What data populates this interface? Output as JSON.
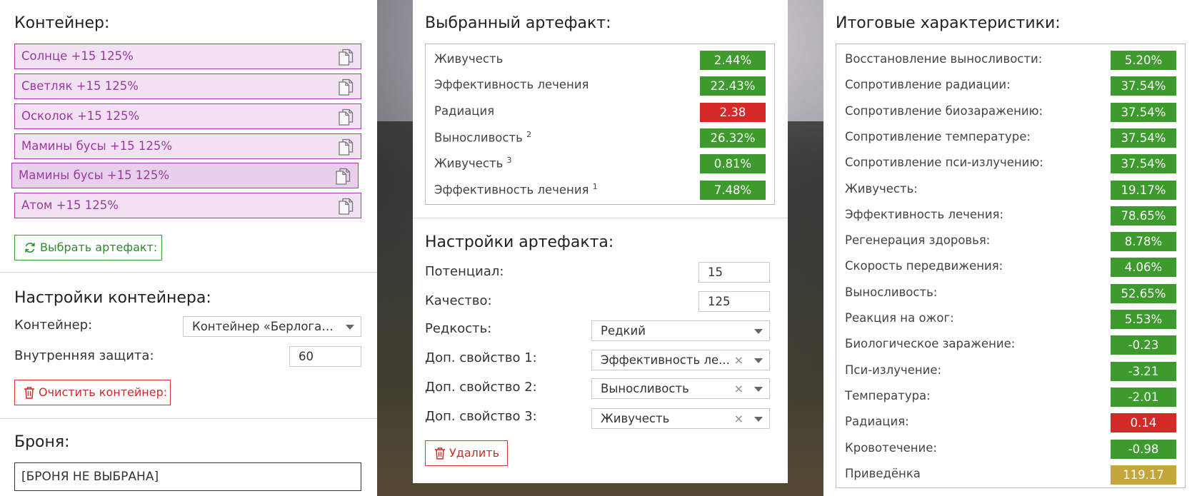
{
  "container": {
    "heading": "Контейнер:",
    "items": [
      "Солнце +15 125%",
      "Светляк +15 125%",
      "Осколок +15 125%",
      "Мамины бусы +15 125%",
      "Мамины бусы +15 125%",
      "Атом +15 125%"
    ],
    "select_button": "Выбрать артефакт:"
  },
  "container_settings": {
    "heading": "Настройки контейнера:",
    "container_label": "Контейнер:",
    "container_value": "Контейнер «Берлога…",
    "protection_label": "Внутренняя защита:",
    "protection_value": "60",
    "clear_button": "Очистить контейнер:"
  },
  "armor": {
    "heading": "Броня:",
    "value": "[БРОНЯ НЕ ВЫБРАНА]"
  },
  "selected_artifact": {
    "heading": "Выбранный артефакт:",
    "rows": [
      {
        "name": "Живучесть",
        "sup": "",
        "value": "2.44%",
        "color": "#3d9a2c"
      },
      {
        "name": "Эффективность лечения",
        "sup": "",
        "value": "22.43%",
        "color": "#3d9a2c"
      },
      {
        "name": "Радиация",
        "sup": "",
        "value": "2.38",
        "color": "#d42a27"
      },
      {
        "name": "Выносливость",
        "sup": "2",
        "value": "26.32%",
        "color": "#3d9a2c"
      },
      {
        "name": "Живучесть",
        "sup": "3",
        "value": "0.81%",
        "color": "#3d9a2c"
      },
      {
        "name": "Эффективность лечения",
        "sup": "1",
        "value": "7.48%",
        "color": "#3d9a2c"
      }
    ]
  },
  "artifact_settings": {
    "heading": "Настройки артефакта:",
    "potential_label": "Потенциал:",
    "potential_value": "15",
    "quality_label": "Качество:",
    "quality_value": "125",
    "rarity_label": "Редкость:",
    "rarity_value": "Редкий",
    "prop1_label": "Доп. свойство 1:",
    "prop1_value": "Эффективность ле...",
    "prop2_label": "Доп. свойство 2:",
    "prop2_value": "Выносливость",
    "prop3_label": "Доп. свойство 3:",
    "prop3_value": "Живучесть",
    "clear_symbol": "×",
    "delete_button": "Удалить"
  },
  "totals": {
    "heading": "Итоговые характеристики:",
    "rows": [
      {
        "name": "Восстановление выносливости:",
        "value": "5.20%",
        "color": "#3d9a2c"
      },
      {
        "name": "Сопротивление радиации:",
        "value": "37.54%",
        "color": "#3d9a2c"
      },
      {
        "name": "Сопротивление биозаражению:",
        "value": "37.54%",
        "color": "#3d9a2c"
      },
      {
        "name": "Сопротивление температуре:",
        "value": "37.54%",
        "color": "#3d9a2c"
      },
      {
        "name": "Сопротивление пси-излучению:",
        "value": "37.54%",
        "color": "#3d9a2c"
      },
      {
        "name": "Живучесть:",
        "value": "19.17%",
        "color": "#3d9a2c"
      },
      {
        "name": "Эффективность лечения:",
        "value": "78.65%",
        "color": "#3d9a2c"
      },
      {
        "name": "Регенерация здоровья:",
        "value": "8.78%",
        "color": "#3d9a2c"
      },
      {
        "name": "Скорость передвижения:",
        "value": "4.06%",
        "color": "#3d9a2c"
      },
      {
        "name": "Выносливость:",
        "value": "52.65%",
        "color": "#3d9a2c"
      },
      {
        "name": "Реакция на ожог:",
        "value": "5.53%",
        "color": "#3d9a2c"
      },
      {
        "name": "Биологическое заражение:",
        "value": "-0.23",
        "color": "#3d9a2c"
      },
      {
        "name": "Пси-излучение:",
        "value": "-3.21",
        "color": "#3d9a2c"
      },
      {
        "name": "Температура:",
        "value": "-2.01",
        "color": "#3d9a2c"
      },
      {
        "name": "Радиация:",
        "value": "0.14",
        "color": "#d42a27"
      },
      {
        "name": "Кровотечение:",
        "value": "-0.98",
        "color": "#3d9a2c"
      },
      {
        "name": "Приведёнка",
        "value": "119.17",
        "color": "#c5a63a"
      }
    ]
  }
}
